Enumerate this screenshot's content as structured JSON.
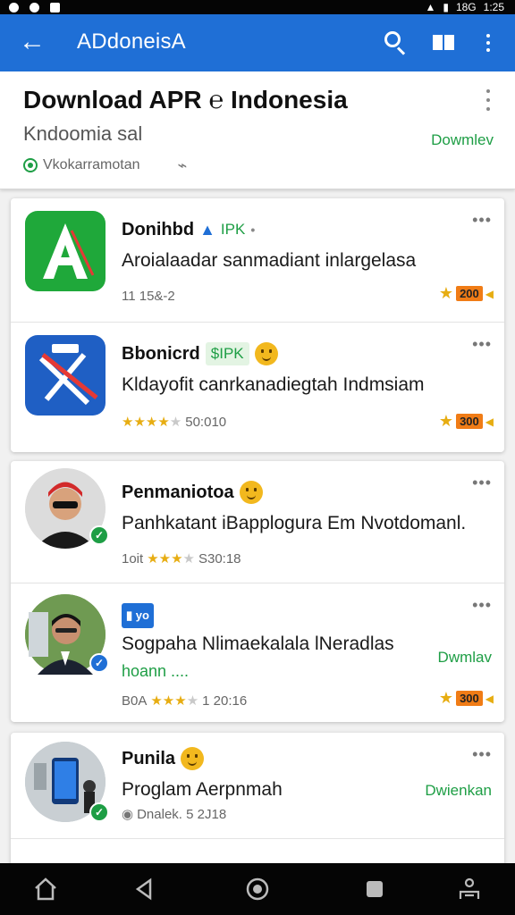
{
  "statusbar": {
    "right_text": "18G",
    "time": "1:25"
  },
  "appbar": {
    "title": "ADdoneisA"
  },
  "header": {
    "title": "Download APR ℮ Indonesia",
    "subtitle": "Kndoomia sal",
    "meta": "Vkokarramotan",
    "download_label": "Dowmlev"
  },
  "card1": {
    "rows": [
      {
        "title": "Donihbd",
        "tag": "IPK",
        "description": "Aroialaadar sanmadiant inlargelasa",
        "meta": "11 15&-2",
        "rating_badge": "200"
      },
      {
        "title": "Bbonicrd",
        "tag": "$IPK",
        "description": "Kldayofit canrkanadiegtah Indmsiam",
        "meta": "50:010",
        "rating_badge": "300"
      }
    ]
  },
  "card2": {
    "rows": [
      {
        "title": "Penmaniotoa",
        "description": "Panhkatant iBapplogura Em Nvotdomanl.",
        "meta_prefix": "1oit",
        "meta": "S30:18"
      },
      {
        "title_tag": "yo",
        "description": "Sogpaha Nlimaekalala lNeradlas",
        "description2": "hoann ....",
        "meta_prefix": "B0A",
        "meta": "1 20:16",
        "download_label": "Dwmlav",
        "rating_badge": "300"
      }
    ]
  },
  "card3": {
    "rows": [
      {
        "title": "Punila",
        "description": "Proglam Aerpnmah",
        "meta": "Dnalek. 5 2J18",
        "download_label": "Dwienkan"
      }
    ]
  },
  "colors": {
    "accent": "#1f6fd6",
    "green": "#1e9e45",
    "star": "#e7ad12"
  }
}
